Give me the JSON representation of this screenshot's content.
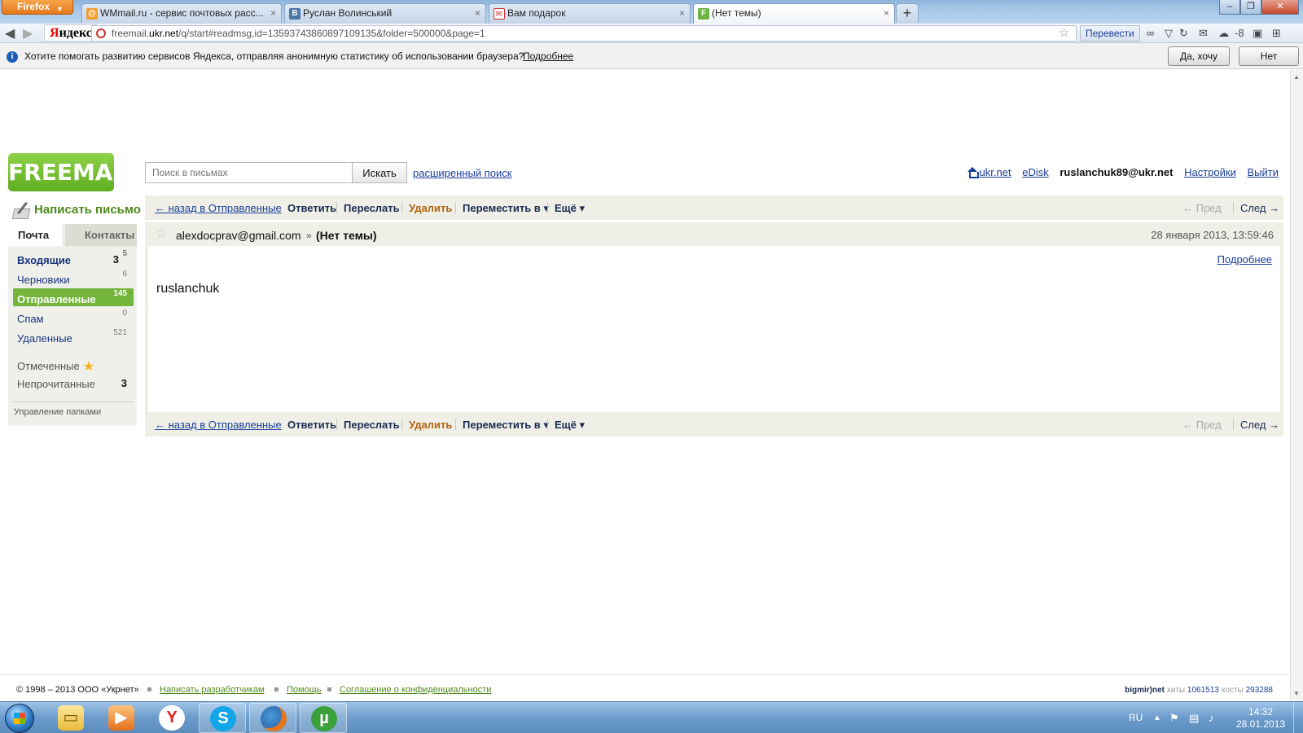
{
  "browser": {
    "menu_button": "Firefox",
    "tabs": [
      {
        "title": "WMmail.ru - сервис почтовых расс...",
        "icon": "wmmail-icon"
      },
      {
        "title": "Руслан Волинський",
        "icon": "vk-icon"
      },
      {
        "title": "Вам подарок",
        "icon": "gift-icon"
      },
      {
        "title": "(Нет темы)",
        "icon": "freemail-icon"
      }
    ],
    "new_tab": "+",
    "yandex_logo": "Яндекс",
    "url": "freemail.ukr.net/q/start#readmsg,id=13593743860897109135&folder=500000&page=1",
    "url_prefix": "freemail.",
    "url_domain": "ukr.net",
    "url_rest": "/q/start#readmsg,id=13593743860897109135&folder=500000&page=1",
    "translate_button": "Перевести",
    "weather": "-8"
  },
  "infobar": {
    "text": "Хотите помогать развитию сервисов Яндекса, отправляя анонимную статистику об использовании браузера?",
    "more_link": "Подробнее",
    "yes_button": "Да, хочу",
    "no_button": "Нет"
  },
  "header": {
    "logo": "FREEMAIL",
    "search_placeholder": "Поиск в письмах",
    "search_button": "Искать",
    "advanced_search": "расширенный поиск",
    "links": {
      "ukrnet": "ukr.net",
      "edisk": "eDisk",
      "user": "ruslanchuk89@ukr.net",
      "settings": "Настройки",
      "logout": "Выйти"
    }
  },
  "sidebar": {
    "compose": "Написать письмо",
    "tabs": {
      "mail": "Почта",
      "contacts": "Контакты"
    },
    "folders": [
      {
        "name": "Входящие",
        "count": "3",
        "sup": "5"
      },
      {
        "name": "Черновики",
        "count": "6"
      },
      {
        "name": "Отправленные",
        "count": "145"
      },
      {
        "name": "Спам",
        "count": "0"
      },
      {
        "name": "Удаленные",
        "count": "521"
      }
    ],
    "starred": "Отмеченные",
    "unread": {
      "name": "Непрочитанные",
      "count": "3"
    },
    "manage_folders": "Управление папками"
  },
  "toolbar": {
    "back": "← назад в Отправленные",
    "reply": "Ответить",
    "forward": "Переслать",
    "delete": "Удалить",
    "move_to": "Переместить в ▾",
    "more": "Ещё ▾",
    "prev": "← Пред",
    "next": "След →"
  },
  "message": {
    "from": "alexdocprav@gmail.com",
    "arrow": "»",
    "subject": "(Нет темы)",
    "date": "28 января 2013, 13:59:46",
    "details_link": "Подробнее",
    "body": "ruslanchuk"
  },
  "footer": {
    "copyright": "© 1998 – 2013 ООО «Укрнет»",
    "links": [
      "Написать разработчикам",
      "Помощь",
      "Соглашение о конфиденциальности"
    ],
    "counter_brand": "bigmir)net",
    "hits_label": "хиты",
    "hits": "1061513",
    "hosts_label": "хосты",
    "hosts": "293288"
  },
  "taskbar": {
    "language": "RU",
    "time": "14:32",
    "date": "28.01.2013"
  }
}
